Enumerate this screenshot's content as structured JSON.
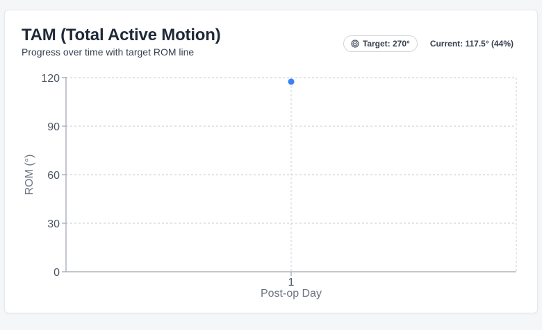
{
  "header": {
    "title": "TAM (Total Active Motion)",
    "subtitle": "Progress over time with target ROM line"
  },
  "badges": {
    "target_label": "Target: 270°",
    "current_label": "Current: 117.5° (44%)"
  },
  "colors": {
    "point": "#3b82f6",
    "grid": "#d1d5db",
    "axis": "#9ca3af"
  },
  "chart_data": {
    "type": "scatter",
    "title": "TAM (Total Active Motion)",
    "subtitle": "Progress over time with target ROM line",
    "xlabel": "Post-op Day",
    "ylabel": "ROM (°)",
    "x_ticks": [
      "1"
    ],
    "y_ticks": [
      0,
      30,
      60,
      90,
      120
    ],
    "ylim": [
      0,
      120
    ],
    "grid": true,
    "points": [
      {
        "x": "1",
        "y": 117.5
      }
    ]
  }
}
